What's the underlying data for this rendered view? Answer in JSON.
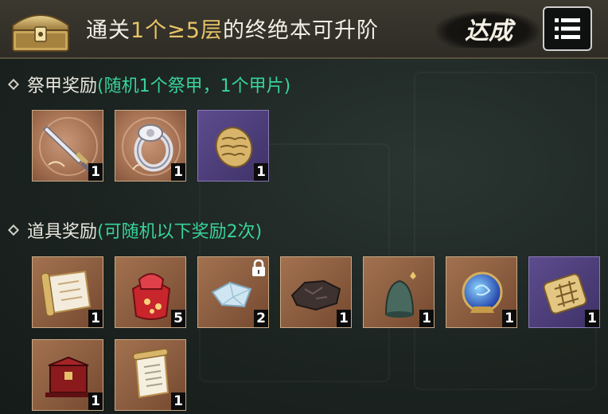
{
  "header": {
    "title_pre": "通关",
    "title_hl": "1个≥5层",
    "title_post": "的终绝本可升阶",
    "stamp": "达成",
    "chest_icon": "treasure-chest-icon",
    "menu_icon": "list-menu-icon"
  },
  "sections": [
    {
      "title": "祭甲奖励",
      "subtitle": "(随机1个祭甲，1个甲片)",
      "items": [
        {
          "icon": "sword-icon",
          "bg": "ornate",
          "count": "1"
        },
        {
          "icon": "ring-icon",
          "bg": "ornate",
          "count": "1"
        },
        {
          "icon": "armor-scale-icon",
          "bg": "purple",
          "count": "1"
        }
      ]
    },
    {
      "title": "道具奖励",
      "subtitle": "(可随机以下奖励2次)",
      "items": [
        {
          "icon": "scroll-map-icon",
          "bg": "brown",
          "count": "1"
        },
        {
          "icon": "red-pouch-icon",
          "bg": "brown",
          "count": "5"
        },
        {
          "icon": "crystal-shard-icon",
          "bg": "brown",
          "count": "2",
          "locked": true
        },
        {
          "icon": "ore-rock-icon",
          "bg": "brown",
          "count": "1"
        },
        {
          "icon": "jade-bell-icon",
          "bg": "brown",
          "count": "1"
        },
        {
          "icon": "blue-orb-icon",
          "bg": "brown",
          "count": "1"
        },
        {
          "icon": "gold-knot-icon",
          "bg": "purple",
          "count": "1"
        },
        {
          "icon": "treasure-box-icon",
          "bg": "brown",
          "count": "1"
        },
        {
          "icon": "paper-scroll-icon",
          "bg": "brown",
          "count": "1"
        }
      ]
    }
  ],
  "colors": {
    "highlight": "#e8c468",
    "subtitle": "#38d39b",
    "header_bg": "#2e2c25"
  }
}
